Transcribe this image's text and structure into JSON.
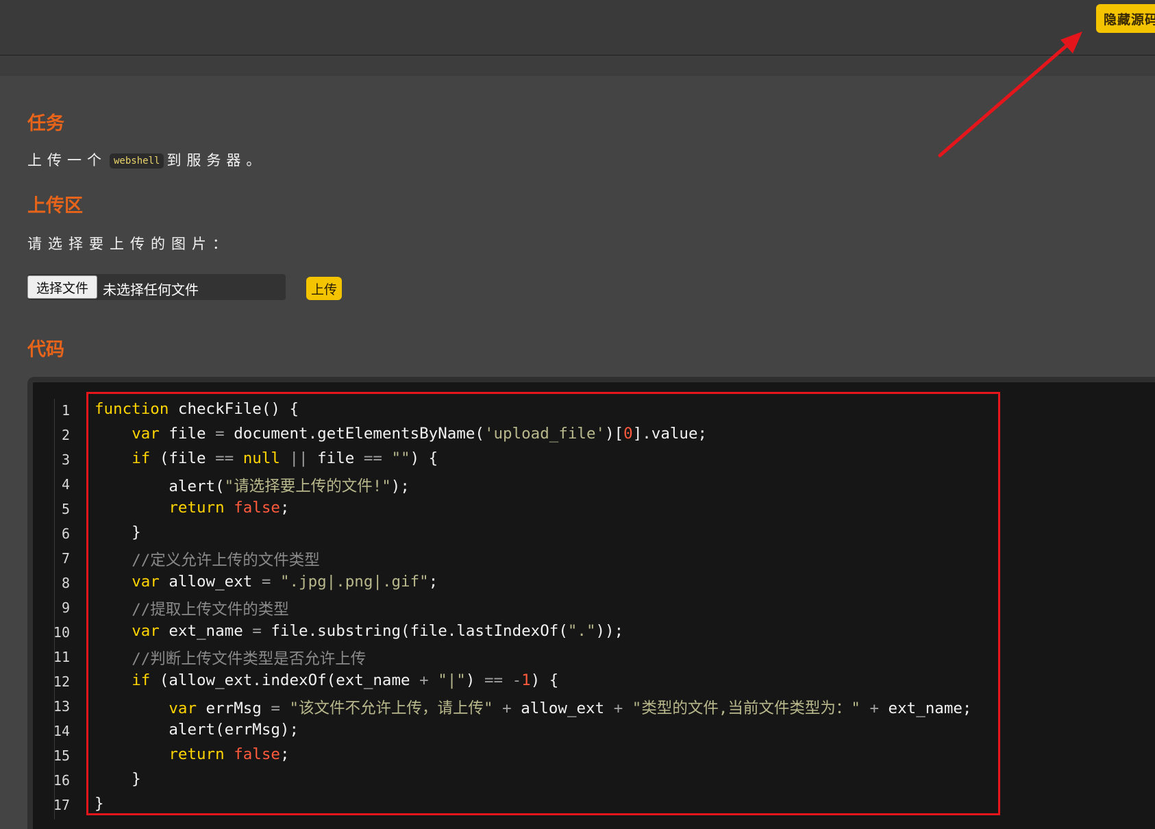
{
  "header": {
    "hide_source_label": "隐藏源码"
  },
  "task": {
    "title": "任务",
    "text_before": "上传一个",
    "chip": "webshell",
    "text_after": "到服务器。"
  },
  "upload": {
    "title": "上传区",
    "prompt": "请选择要上传的图片：",
    "choose_file_label": "选择文件",
    "file_status": "未选择任何文件",
    "upload_label": "上传"
  },
  "code": {
    "title": "代码",
    "line_numbers": [
      "1",
      "2",
      "3",
      "4",
      "5",
      "6",
      "7",
      "8",
      "9",
      "10",
      "11",
      "12",
      "13",
      "14",
      "15",
      "16",
      "17"
    ],
    "lines": [
      "function checkFile() {",
      "    var file = document.getElementsByName('upload_file')[0].value;",
      "    if (file == null || file == \"\") {",
      "        alert(\"请选择要上传的文件!\");",
      "        return false;",
      "    }",
      "    //定义允许上传的文件类型",
      "    var allow_ext = \".jpg|.png|.gif\";",
      "    //提取上传文件的类型",
      "    var ext_name = file.substring(file.lastIndexOf(\".\"));",
      "    //判断上传文件类型是否允许上传",
      "    if (allow_ext.indexOf(ext_name + \"|\") == -1) {",
      "        var errMsg = \"该文件不允许上传，请上传\" + allow_ext + \"类型的文件,当前文件类型为：\" + ext_name;",
      "        alert(errMsg);",
      "        return false;",
      "    }",
      "}"
    ]
  },
  "colors": {
    "accent_orange": "#e8641a",
    "button_yellow": "#f5c400",
    "annotation_red": "#e5161b"
  }
}
